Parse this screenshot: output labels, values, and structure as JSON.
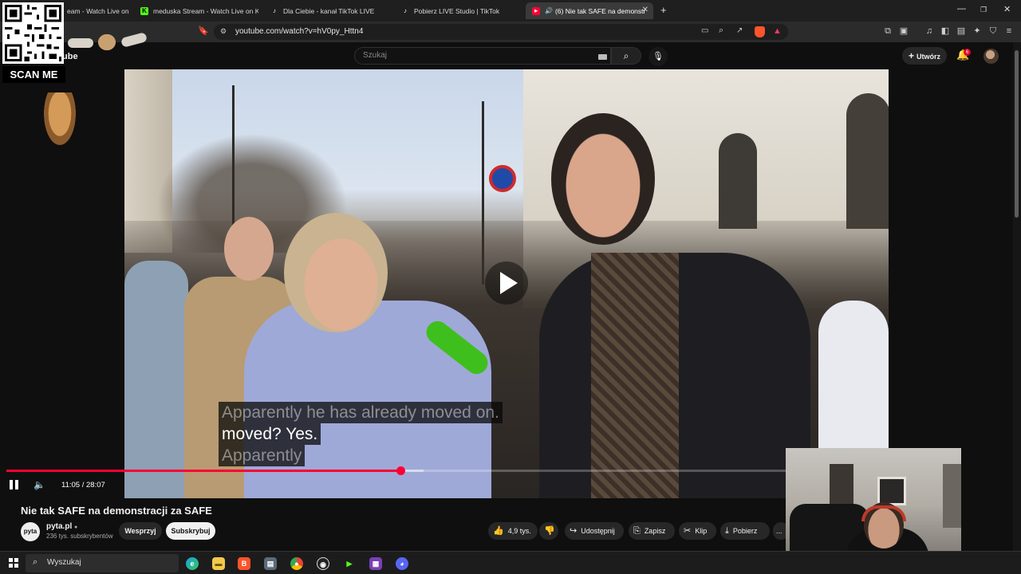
{
  "browser": {
    "tabs": [
      {
        "label": "eam - Watch Live on",
        "icon": "kick-icon",
        "active": false
      },
      {
        "label": "meduska Stream - Watch Live on Kic",
        "icon": "kick-icon",
        "active": false
      },
      {
        "label": "Dla Ciebie - kanał TikTok LIVE",
        "icon": "tiktok-icon",
        "active": false
      },
      {
        "label": "Pobierz LIVE Studio | TikTok",
        "icon": "tiktok-icon",
        "active": false
      },
      {
        "label": "(6) Nie tak SAFE na demonstr",
        "icon": "youtube-icon",
        "active": true
      }
    ],
    "new_tab_symbol": "+",
    "url": "youtube.com/watch?v=hV0py_Httn4",
    "accent_color": "#ff0033"
  },
  "youtube": {
    "logo_partial": "ube",
    "search_placeholder": "Szukaj",
    "create_label": "Utwórz",
    "notifications_count": "6"
  },
  "video": {
    "subtitle_lines": [
      "Apparently he has already moved on.",
      "moved?  Yes.",
      "Apparently"
    ],
    "time_current": "11:05",
    "time_separator": " / ",
    "time_total": "28:07",
    "progress_fraction": 0.444,
    "buffered_fraction": 0.47
  },
  "meta": {
    "title": "Nie tak SAFE na demonstracji za SAFE",
    "channel_name": "pyta.pl",
    "channel_avatar_text": "pyta",
    "subscribers": "236 tys. subskrybentów",
    "support_label": "Wesprzyj",
    "subscribe_label": "Subskrybuj",
    "likes": "4,9 tys.",
    "share_label": "Udostępnij",
    "save_label": "Zapisz",
    "clip_label": "Klip",
    "download_label": "Pobierz",
    "more_label": "..."
  },
  "overlay": {
    "scan_label": "SCAN ME"
  },
  "taskbar": {
    "search_placeholder": "Wyszukaj"
  }
}
